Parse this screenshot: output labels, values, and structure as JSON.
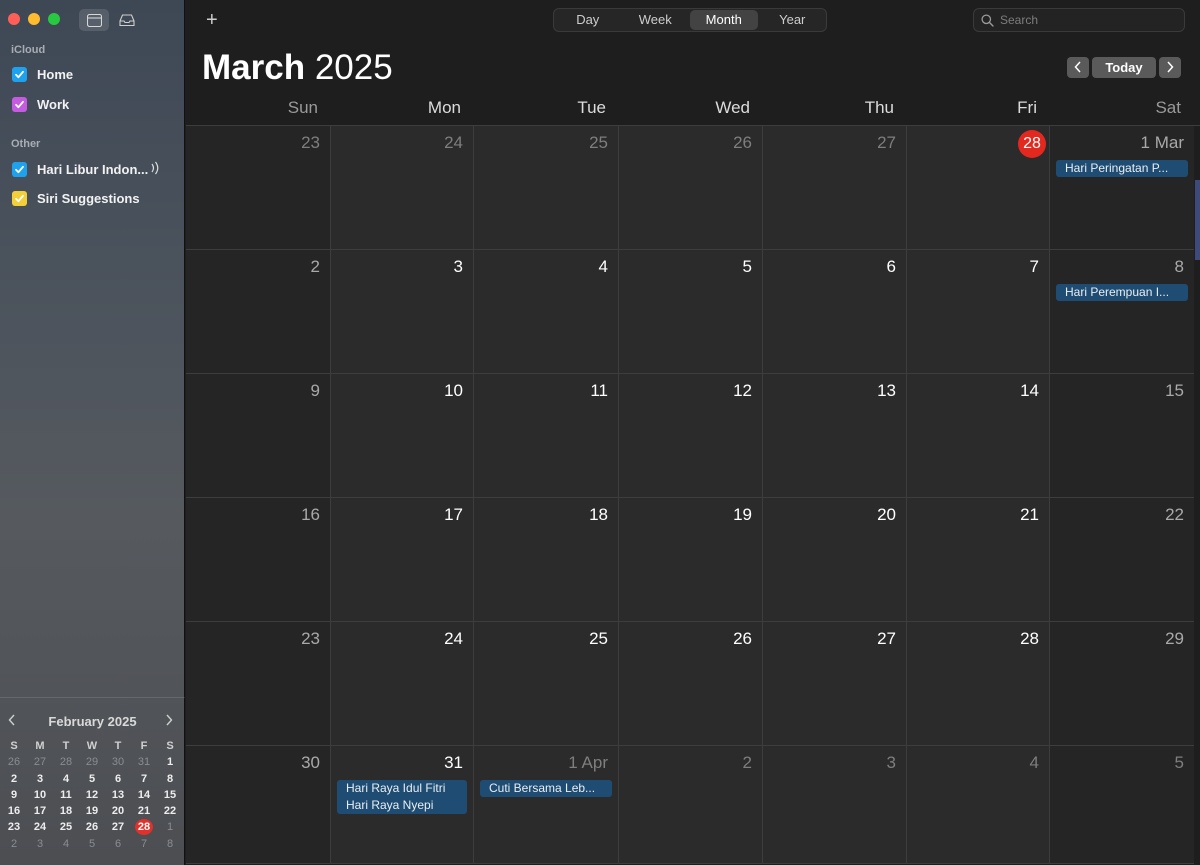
{
  "sidebar": {
    "sections": {
      "icloud": "iCloud",
      "other": "Other"
    },
    "calendars": [
      {
        "label": "Home",
        "color": "#1fa2ee"
      },
      {
        "label": "Work",
        "color": "#c45be0"
      },
      {
        "label": "Hari Libur Indonesia",
        "display": "Hari Libur Indon...",
        "color": "#1fa2ee"
      },
      {
        "label": "Siri Suggestions",
        "color": "#f3cf3a"
      }
    ],
    "mini_calendar": {
      "title": "February 2025",
      "weekdays": [
        "S",
        "M",
        "T",
        "W",
        "T",
        "F",
        "S"
      ],
      "weeks": [
        [
          "26",
          "27",
          "28",
          "29",
          "30",
          "31",
          "1"
        ],
        [
          "2",
          "3",
          "4",
          "5",
          "6",
          "7",
          "8"
        ],
        [
          "9",
          "10",
          "11",
          "12",
          "13",
          "14",
          "15"
        ],
        [
          "16",
          "17",
          "18",
          "19",
          "20",
          "21",
          "22"
        ],
        [
          "23",
          "24",
          "25",
          "26",
          "27",
          "28",
          "1"
        ],
        [
          "2",
          "3",
          "4",
          "5",
          "6",
          "7",
          "8"
        ]
      ],
      "today": "28"
    }
  },
  "toolbar": {
    "add_label": "+",
    "views": [
      "Day",
      "Week",
      "Month",
      "Year"
    ],
    "active_view": "Month",
    "search_placeholder": "Search"
  },
  "header": {
    "month": "March",
    "year": "2025",
    "today_label": "Today",
    "prev_icon": "chevron-left",
    "next_icon": "chevron-right"
  },
  "weekdays": [
    "Sun",
    "Mon",
    "Tue",
    "Wed",
    "Thu",
    "Fri",
    "Sat"
  ],
  "weeks": [
    [
      {
        "day": "23",
        "dim": true
      },
      {
        "day": "24",
        "dim": true
      },
      {
        "day": "25",
        "dim": true
      },
      {
        "day": "26",
        "dim": true
      },
      {
        "day": "27",
        "dim": true
      },
      {
        "day": "28",
        "today": true
      },
      {
        "day": "1 Mar",
        "events": [
          "Hari Peringatan Pembebasan"
        ],
        "event_display": [
          "Hari Peringatan P..."
        ]
      }
    ],
    [
      {
        "day": "2"
      },
      {
        "day": "3"
      },
      {
        "day": "4"
      },
      {
        "day": "5"
      },
      {
        "day": "6"
      },
      {
        "day": "7"
      },
      {
        "day": "8",
        "events": [
          "Hari Perempuan Internasional"
        ],
        "event_display": [
          "Hari Perempuan I..."
        ]
      }
    ],
    [
      {
        "day": "9"
      },
      {
        "day": "10"
      },
      {
        "day": "11"
      },
      {
        "day": "12"
      },
      {
        "day": "13"
      },
      {
        "day": "14"
      },
      {
        "day": "15"
      }
    ],
    [
      {
        "day": "16"
      },
      {
        "day": "17"
      },
      {
        "day": "18"
      },
      {
        "day": "19"
      },
      {
        "day": "20"
      },
      {
        "day": "21"
      },
      {
        "day": "22"
      }
    ],
    [
      {
        "day": "23"
      },
      {
        "day": "24"
      },
      {
        "day": "25"
      },
      {
        "day": "26"
      },
      {
        "day": "27"
      },
      {
        "day": "28"
      },
      {
        "day": "29"
      }
    ],
    [
      {
        "day": "30"
      },
      {
        "day": "31",
        "events": [
          "Hari Raya Idul Fitri",
          "Hari Raya Nyepi"
        ],
        "event_display": [
          "Hari Raya Idul Fitri",
          "Hari Raya Nyepi"
        ]
      },
      {
        "day": "1 Apr",
        "dim": true,
        "events": [
          "Cuti Bersama Lebaran"
        ],
        "event_display": [
          "Cuti Bersama Leb..."
        ]
      },
      {
        "day": "2",
        "dim": true
      },
      {
        "day": "3",
        "dim": true
      },
      {
        "day": "4",
        "dim": true
      },
      {
        "day": "5",
        "dim": true
      }
    ]
  ],
  "colors": {
    "today": "#e3281f",
    "event": "#1e4c72",
    "accent_blue": "#1fa2ee"
  }
}
